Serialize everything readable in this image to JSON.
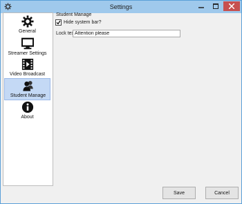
{
  "window": {
    "title": "Settings"
  },
  "titlebar": {
    "icons": [
      "gear-icon",
      "minimize-icon",
      "maximize-icon",
      "close-icon"
    ]
  },
  "sidebar": {
    "items": [
      {
        "label": "General",
        "icon": "gear-icon",
        "selected": false
      },
      {
        "label": "Streamer Settings",
        "icon": "monitor-icon",
        "selected": false
      },
      {
        "label": "Video Broadcast",
        "icon": "film-icon",
        "selected": false
      },
      {
        "label": "Student Manage",
        "icon": "users-icon",
        "selected": true
      },
      {
        "label": "About",
        "icon": "info-icon",
        "selected": false
      }
    ],
    "selected_color": "#c4d9f5"
  },
  "content": {
    "section_title": "Student Manage",
    "hide_system_bar": {
      "label": "Hide system bar?",
      "checked": true
    },
    "lock_text": {
      "label": "Lock text",
      "value": "Attention please"
    }
  },
  "footer": {
    "save_label": "Save",
    "cancel_label": "Cancel"
  },
  "colors": {
    "titlebar": "#9fc9ec",
    "close_button": "#c75050",
    "border": "#5aa0d8"
  }
}
